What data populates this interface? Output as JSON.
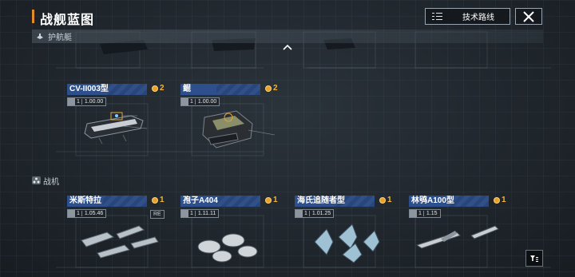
{
  "header": {
    "title": "战舰蓝图",
    "tech_route_label": "技术路线",
    "accent_color": "#e38b2a"
  },
  "sections": {
    "escort_label": "护航艇",
    "fighter_label": "战机"
  },
  "escort_cards": [
    {
      "name": "CV-II003型",
      "cost": "2",
      "level": "1",
      "level_value": "1.00.00"
    },
    {
      "name": "鲲",
      "cost": "2",
      "level": "1",
      "level_value": "1.00.00"
    }
  ],
  "fighter_cards": [
    {
      "name": "米斯特拉",
      "cost": "1",
      "level": "1",
      "level_value": "1.05.46",
      "tag": "RE"
    },
    {
      "name": "孢子A404",
      "cost": "1",
      "level": "1",
      "level_value": "1.11.11"
    },
    {
      "name": "海氏追随者型",
      "cost": "1",
      "level": "1",
      "level_value": "1.01.25"
    },
    {
      "name": "林鸮A100型",
      "cost": "1",
      "level": "1",
      "level_value": "1.15"
    }
  ],
  "icons": {
    "tech_route": "list-icon",
    "close": "close-icon",
    "collapse": "chevron-up-icon",
    "filter": "filter-icon"
  },
  "colors": {
    "card_title_bg": "#2d4f8c",
    "cost_color": "#f0b43c"
  }
}
